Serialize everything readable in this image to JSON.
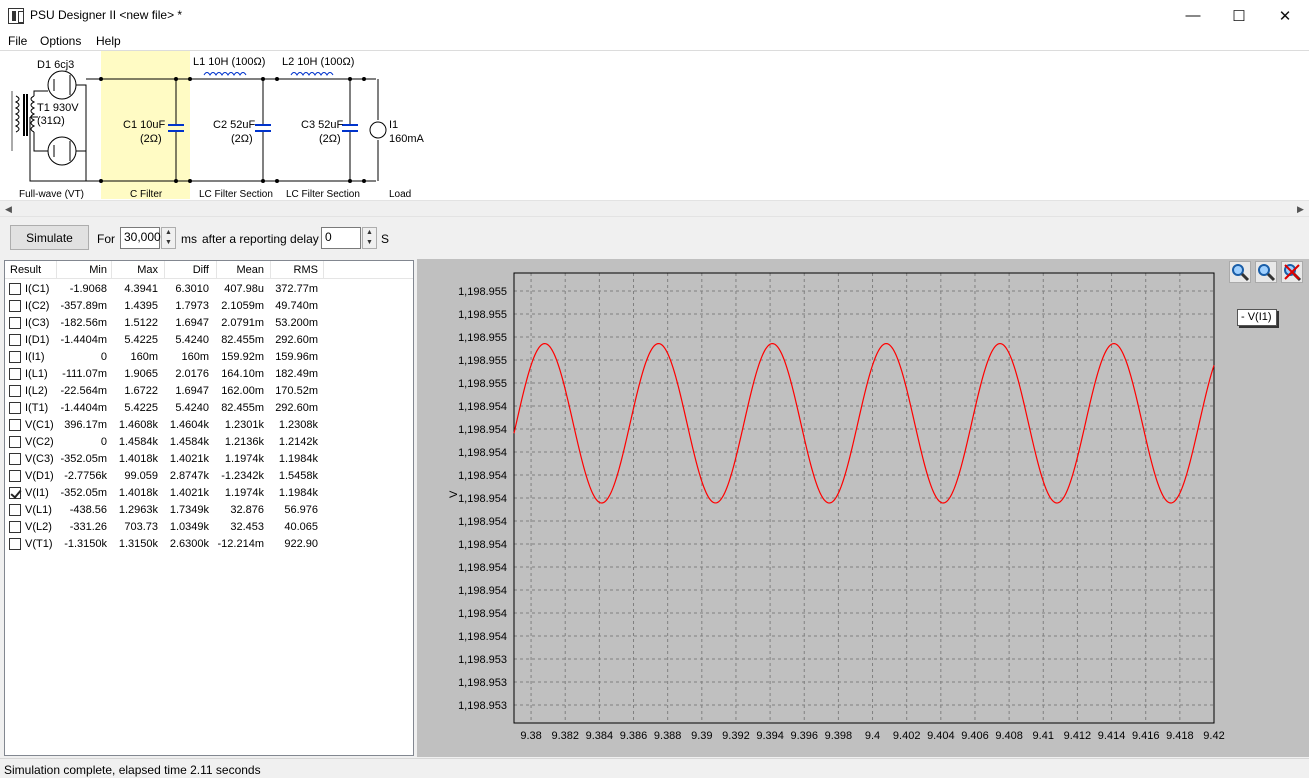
{
  "window": {
    "title": "PSU Designer II  <new file> *",
    "minimize_glyph": "—",
    "maximize_glyph": "☐",
    "close_glyph": "✕"
  },
  "menu": [
    "File",
    "Options",
    "Help"
  ],
  "schematic": {
    "rectifier": {
      "diode": "D1 6cj3",
      "transformer_v": "T1 930V",
      "transformer_r": "(31Ω)",
      "section": "Full-wave (VT)"
    },
    "c1": {
      "label": "C1 10uF",
      "esr": "(2Ω)",
      "section": "C Filter"
    },
    "l1": {
      "label": "L1 10H (100Ω)"
    },
    "c2": {
      "label": "C2 52uF",
      "esr": "(2Ω)",
      "section": "LC Filter Section"
    },
    "l2": {
      "label": "L2 10H (100Ω)"
    },
    "c3": {
      "label": "C3 52uF",
      "esr": "(2Ω)",
      "section": "LC Filter Section"
    },
    "load": {
      "label": "I1",
      "value": "160mA",
      "section": "Load"
    }
  },
  "toolbar": {
    "simulate_label": "Simulate",
    "for_label": "For",
    "duration_value": "30,000",
    "ms_label": "ms",
    "delay_label": "after a reporting delay of",
    "delay_value": "0",
    "s_label": "S"
  },
  "results": {
    "columns": [
      "Result",
      "Min",
      "Max",
      "Diff",
      "Mean",
      "RMS"
    ],
    "rows": [
      {
        "name": "I(C1)",
        "min": "-1.9068",
        "max": "4.3941",
        "diff": "6.3010",
        "mean": "407.98u",
        "rms": "372.77m",
        "checked": false
      },
      {
        "name": "I(C2)",
        "min": "-357.89m",
        "max": "1.4395",
        "diff": "1.7973",
        "mean": "2.1059m",
        "rms": "49.740m",
        "checked": false
      },
      {
        "name": "I(C3)",
        "min": "-182.56m",
        "max": "1.5122",
        "diff": "1.6947",
        "mean": "2.0791m",
        "rms": "53.200m",
        "checked": false
      },
      {
        "name": "I(D1)",
        "min": "-1.4404m",
        "max": "5.4225",
        "diff": "5.4240",
        "mean": "82.455m",
        "rms": "292.60m",
        "checked": false
      },
      {
        "name": "I(I1)",
        "min": "0",
        "max": "160m",
        "diff": "160m",
        "mean": "159.92m",
        "rms": "159.96m",
        "checked": false
      },
      {
        "name": "I(L1)",
        "min": "-111.07m",
        "max": "1.9065",
        "diff": "2.0176",
        "mean": "164.10m",
        "rms": "182.49m",
        "checked": false
      },
      {
        "name": "I(L2)",
        "min": "-22.564m",
        "max": "1.6722",
        "diff": "1.6947",
        "mean": "162.00m",
        "rms": "170.52m",
        "checked": false
      },
      {
        "name": "I(T1)",
        "min": "-1.4404m",
        "max": "5.4225",
        "diff": "5.4240",
        "mean": "82.455m",
        "rms": "292.60m",
        "checked": false
      },
      {
        "name": "V(C1)",
        "min": "396.17m",
        "max": "1.4608k",
        "diff": "1.4604k",
        "mean": "1.2301k",
        "rms": "1.2308k",
        "checked": false
      },
      {
        "name": "V(C2)",
        "min": "0",
        "max": "1.4584k",
        "diff": "1.4584k",
        "mean": "1.2136k",
        "rms": "1.2142k",
        "checked": false
      },
      {
        "name": "V(C3)",
        "min": "-352.05m",
        "max": "1.4018k",
        "diff": "1.4021k",
        "mean": "1.1974k",
        "rms": "1.1984k",
        "checked": false
      },
      {
        "name": "V(D1)",
        "min": "-2.7756k",
        "max": "99.059",
        "diff": "2.8747k",
        "mean": "-1.2342k",
        "rms": "1.5458k",
        "checked": false
      },
      {
        "name": "V(I1)",
        "min": "-352.05m",
        "max": "1.4018k",
        "diff": "1.4021k",
        "mean": "1.1974k",
        "rms": "1.1984k",
        "checked": true
      },
      {
        "name": "V(L1)",
        "min": "-438.56",
        "max": "1.2963k",
        "diff": "1.7349k",
        "mean": "32.876",
        "rms": "56.976",
        "checked": false
      },
      {
        "name": "V(L2)",
        "min": "-331.26",
        "max": "703.73",
        "diff": "1.0349k",
        "mean": "32.453",
        "rms": "40.065",
        "checked": false
      },
      {
        "name": "V(T1)",
        "min": "-1.3150k",
        "max": "1.3150k",
        "diff": "2.6300k",
        "mean": "-12.214m",
        "rms": "922.90",
        "checked": false
      }
    ]
  },
  "chart_data": {
    "type": "line",
    "title": "",
    "xlabel": "",
    "ylabel": "V",
    "xlim": [
      9.379,
      9.42
    ],
    "ylim": [
      1198.9529,
      1198.95561
    ],
    "x_ticks": [
      "9.38",
      "9.382",
      "9.384",
      "9.386",
      "9.388",
      "9.39",
      "9.392",
      "9.394",
      "9.396",
      "9.398",
      "9.4",
      "9.402",
      "9.404",
      "9.406",
      "9.408",
      "9.41",
      "9.412",
      "9.414",
      "9.416",
      "9.418",
      "9.42"
    ],
    "y_ticks": [
      "1,198.955",
      "1,198.955",
      "1,198.955",
      "1,198.955",
      "1,198.955",
      "1,198.954",
      "1,198.954",
      "1,198.954",
      "1,198.954",
      "1,198.954",
      "1,198.954",
      "1,198.954",
      "1,198.954",
      "1,198.954",
      "1,198.954",
      "1,198.954",
      "1,198.953",
      "1,198.953",
      "1,198.953"
    ],
    "grid": true,
    "legend_position": "top-right",
    "series": [
      {
        "name": "V(I1)",
        "color": "#ff0000",
        "amplitude": 0.00048,
        "offset": 1198.954705,
        "period": 0.006667,
        "peak_x": 9.3808,
        "x_start": 9.379,
        "x_end": 9.42
      }
    ],
    "legend_label": "- V(I1)",
    "plot_bg": "#c0c0c0"
  },
  "status": {
    "text": "Simulation complete, elapsed time 2.11 seconds"
  }
}
